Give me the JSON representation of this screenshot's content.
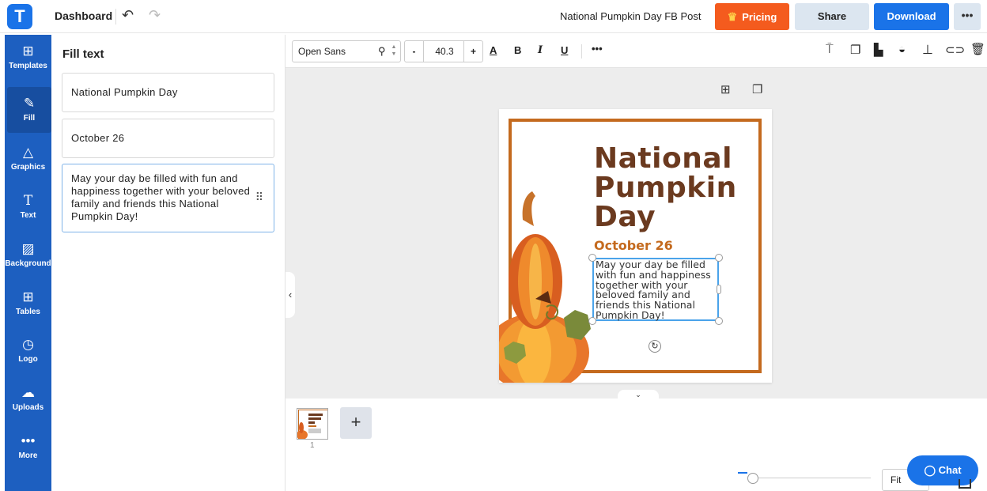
{
  "topbar": {
    "dashboard_label": "Dashboard",
    "document_title": "National Pumpkin Day FB Post",
    "pricing_label": "Pricing",
    "share_label": "Share",
    "download_label": "Download"
  },
  "sidebar": {
    "items": [
      {
        "label": "Templates",
        "icon": "templates-icon"
      },
      {
        "label": "Fill",
        "icon": "pencil-icon"
      },
      {
        "label": "Graphics",
        "icon": "shapes-icon"
      },
      {
        "label": "Text",
        "icon": "text-icon"
      },
      {
        "label": "Background",
        "icon": "background-icon"
      },
      {
        "label": "Tables",
        "icon": "table-icon"
      },
      {
        "label": "Logo",
        "icon": "logo-icon"
      },
      {
        "label": "Uploads",
        "icon": "cloud-upload-icon"
      },
      {
        "label": "More",
        "icon": "more-dots-icon"
      }
    ],
    "active": "Fill"
  },
  "panel": {
    "title": "Fill text",
    "fields": [
      {
        "value": "National Pumpkin Day"
      },
      {
        "value": "October 26"
      },
      {
        "value": "May your day be filled with fun and happiness together with your beloved family and friends this National Pumpkin Day!"
      }
    ]
  },
  "toolbar": {
    "font_family": "Open Sans",
    "font_size": "40.3"
  },
  "design": {
    "headline": "National Pumpkin Day",
    "date": "October 26",
    "body": "May your day be filled with fun and happiness together with your beloved family and friends this National Pumpkin Day!",
    "colors": {
      "frame": "#c46a1e",
      "headline": "#6b3a1f",
      "date": "#c46a1e"
    }
  },
  "pages": {
    "current": "1"
  },
  "zoom": {
    "fit_label": "Fit"
  },
  "chat": {
    "label": "Chat"
  },
  "colors": {
    "accent": "#1a73e8",
    "pricing": "#f45b1e",
    "sidebar": "#1d5fc0"
  }
}
